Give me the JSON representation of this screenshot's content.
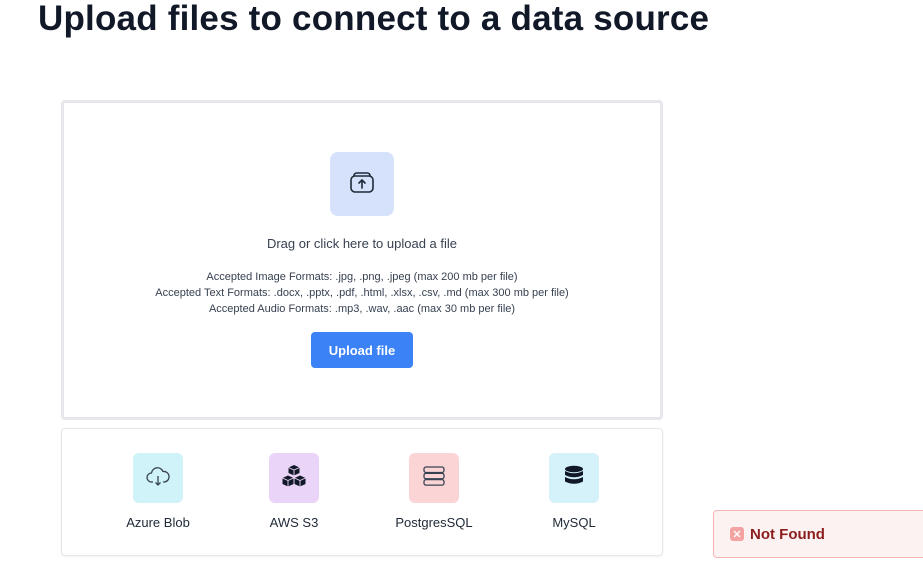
{
  "page": {
    "title": "Upload files to connect to a data source"
  },
  "dropzone": {
    "hint": "Drag or click here to upload a file",
    "formats": [
      "Accepted Image Formats: .jpg, .png, .jpeg (max 200 mb per file)",
      "Accepted Text Formats: .docx, .pptx, .pdf, .html, .xlsx, .csv, .md (max 300 mb per file)",
      "Accepted Audio Formats: .mp3, .wav, .aac (max 30 mb per file)"
    ],
    "upload_button_label": "Upload file",
    "icon": "upload-icon"
  },
  "sources": [
    {
      "label": "Azure Blob",
      "icon": "cloud-download-icon",
      "tile_color": "#cff3f8"
    },
    {
      "label": "AWS S3",
      "icon": "cubes-icon",
      "tile_color": "#ead4f7"
    },
    {
      "label": "PostgresSQL",
      "icon": "server-icon",
      "tile_color": "#fbd5d5"
    },
    {
      "label": "MySQL",
      "icon": "database-icon",
      "tile_color": "#d5f1fa"
    }
  ],
  "toast": {
    "message": "Not Found",
    "icon": "close-icon"
  },
  "colors": {
    "primary": "#3b82f6",
    "upload_tile": "#d6e2fb",
    "error_text": "#8b1d1d",
    "error_bg": "#fdf2f2"
  }
}
